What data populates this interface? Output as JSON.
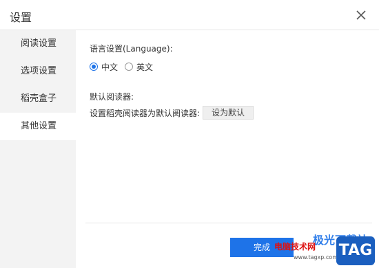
{
  "window": {
    "title": "设置"
  },
  "sidebar": {
    "items": [
      {
        "label": "阅读设置",
        "active": false
      },
      {
        "label": "选项设置",
        "active": false
      },
      {
        "label": "稻壳盒子",
        "active": false
      },
      {
        "label": "其他设置",
        "active": true
      }
    ]
  },
  "language": {
    "label": "语言设置(Language):",
    "options": [
      {
        "label": "中文",
        "selected": true
      },
      {
        "label": "英文",
        "selected": false
      }
    ]
  },
  "reader": {
    "label": "默认阅读器:",
    "description": "设置稻壳阅读器为默认阅读器:",
    "button_label": "设为默认"
  },
  "footer": {
    "done_label": "完成"
  },
  "watermark": {
    "line1": "电脑技术网",
    "big": "极光下载站",
    "url": "www.tagxp.com",
    "tag": "TAG"
  },
  "colors": {
    "accent": "#1e73e8",
    "sidebar_bg": "#f3f3f3"
  }
}
